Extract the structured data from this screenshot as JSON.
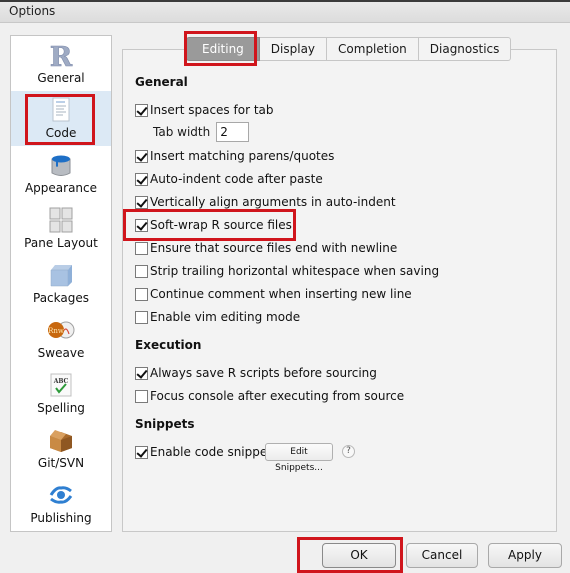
{
  "window": {
    "title": "Options"
  },
  "sidebar": {
    "items": [
      {
        "label": "General",
        "icon": "r-logo-icon"
      },
      {
        "label": "Code",
        "icon": "code-document-icon",
        "selected": true
      },
      {
        "label": "Appearance",
        "icon": "paint-bucket-icon"
      },
      {
        "label": "Pane Layout",
        "icon": "pane-grid-icon"
      },
      {
        "label": "Packages",
        "icon": "package-cube-icon"
      },
      {
        "label": "Sweave",
        "icon": "sweave-pdf-icon"
      },
      {
        "label": "Spelling",
        "icon": "abc-check-icon"
      },
      {
        "label": "Git/SVN",
        "icon": "cardboard-box-icon"
      },
      {
        "label": "Publishing",
        "icon": "publish-eye-icon"
      }
    ]
  },
  "tabs": [
    {
      "label": "Editing",
      "active": true
    },
    {
      "label": "Display"
    },
    {
      "label": "Completion"
    },
    {
      "label": "Diagnostics"
    }
  ],
  "editing": {
    "general": {
      "heading": "General",
      "insert_spaces": {
        "label": "Insert spaces for tab",
        "checked": true
      },
      "tab_width": {
        "label": "Tab width",
        "value": "2"
      },
      "options": [
        {
          "label": "Insert matching parens/quotes",
          "checked": true
        },
        {
          "label": "Auto-indent code after paste",
          "checked": true
        },
        {
          "label": "Vertically align arguments in auto-indent",
          "checked": true
        },
        {
          "label": "Soft-wrap R source files",
          "checked": true
        },
        {
          "label": "Ensure that source files end with newline",
          "checked": false
        },
        {
          "label": "Strip trailing horizontal whitespace when saving",
          "checked": false
        },
        {
          "label": "Continue comment when inserting new line",
          "checked": false
        },
        {
          "label": "Enable vim editing mode",
          "checked": false
        }
      ]
    },
    "execution": {
      "heading": "Execution",
      "options": [
        {
          "label": "Always save R scripts before sourcing",
          "checked": true
        },
        {
          "label": "Focus console after executing from source",
          "checked": false
        }
      ]
    },
    "snippets": {
      "heading": "Snippets",
      "enable": {
        "label": "Enable code snippets",
        "checked": true
      },
      "edit_button": "Edit Snippets...",
      "help": "?"
    }
  },
  "buttons": {
    "ok": "OK",
    "cancel": "Cancel",
    "apply": "Apply"
  },
  "colors": {
    "highlight": "#d0151c",
    "selected_sidebar": "#dce9f5",
    "active_tab": "#9a9a9a"
  }
}
